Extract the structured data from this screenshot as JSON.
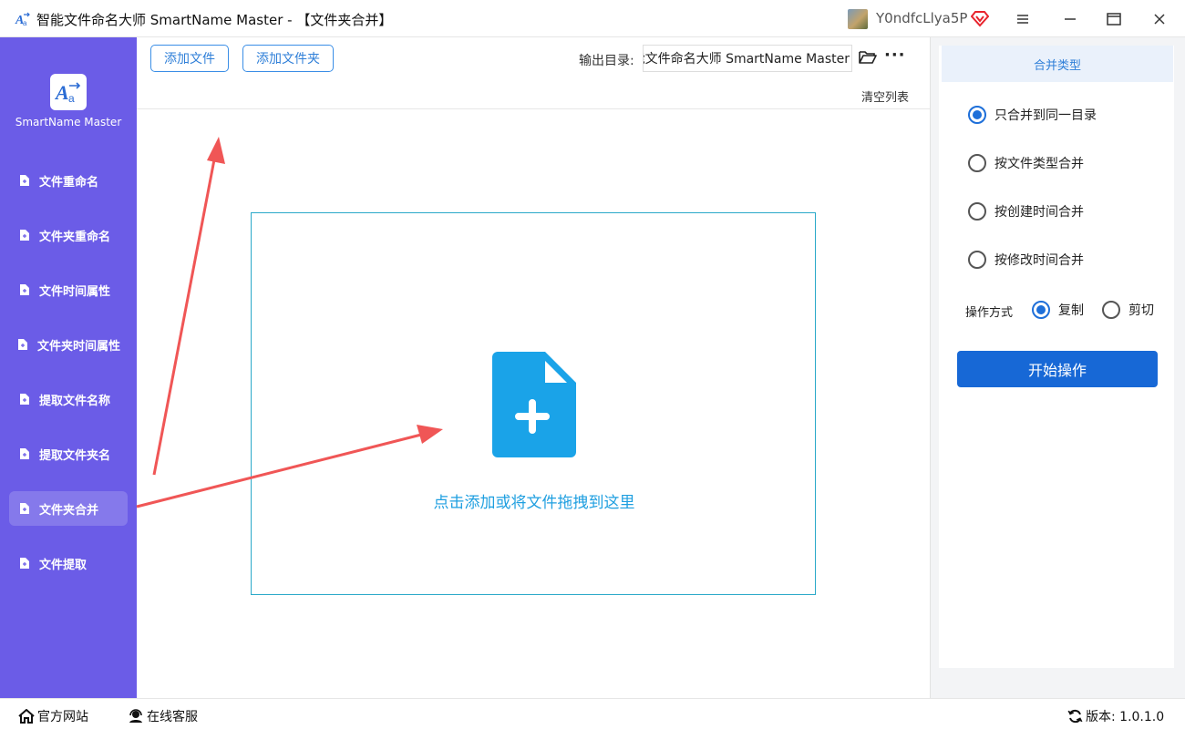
{
  "window": {
    "title": "智能文件命名大师 SmartName Master - 【文件夹合并】",
    "username": "Y0ndfcLlya5P",
    "icons": [
      "app-logo-icon",
      "vip-diamond-icon",
      "menu-icon",
      "minimize-icon",
      "maximize-icon",
      "close-icon"
    ]
  },
  "sidebar": {
    "logo_text": "SmartName Master",
    "items": [
      {
        "label": "文件重命名",
        "active": false
      },
      {
        "label": "文件夹重命名",
        "active": false
      },
      {
        "label": "文件时间属性",
        "active": false
      },
      {
        "label": "文件夹时间属性",
        "active": false
      },
      {
        "label": "提取文件名称",
        "active": false
      },
      {
        "label": "提取文件夹名",
        "active": false
      },
      {
        "label": "文件夹合并",
        "active": true
      },
      {
        "label": "文件提取",
        "active": false
      }
    ]
  },
  "toolbar": {
    "add_file": "添加文件",
    "add_folder": "添加文件夹",
    "output_label": "输出目录:",
    "output_value": "智能文件命名大师 SmartName Master",
    "clear_list": "清空列表",
    "more": "···"
  },
  "dropzone": {
    "text": "点击添加或将文件拖拽到这里"
  },
  "right_panel": {
    "header": "合并类型",
    "merge_options": [
      {
        "label": "只合并到同一目录",
        "checked": true
      },
      {
        "label": "按文件类型合并",
        "checked": false
      },
      {
        "label": "按创建时间合并",
        "checked": false
      },
      {
        "label": "按修改时间合并",
        "checked": false
      }
    ],
    "operation_label": "操作方式",
    "operation_options": [
      {
        "label": "复制",
        "checked": true
      },
      {
        "label": "剪切",
        "checked": false
      }
    ],
    "start_button": "开始操作"
  },
  "statusbar": {
    "website": "官方网站",
    "support": "在线客服",
    "version": "版本:  1.0.1.0"
  },
  "colors": {
    "sidebar": "#6b5ce7",
    "accent": "#1768d6",
    "dropzone_text": "#1f9fe0",
    "arrow": "#f05656"
  }
}
